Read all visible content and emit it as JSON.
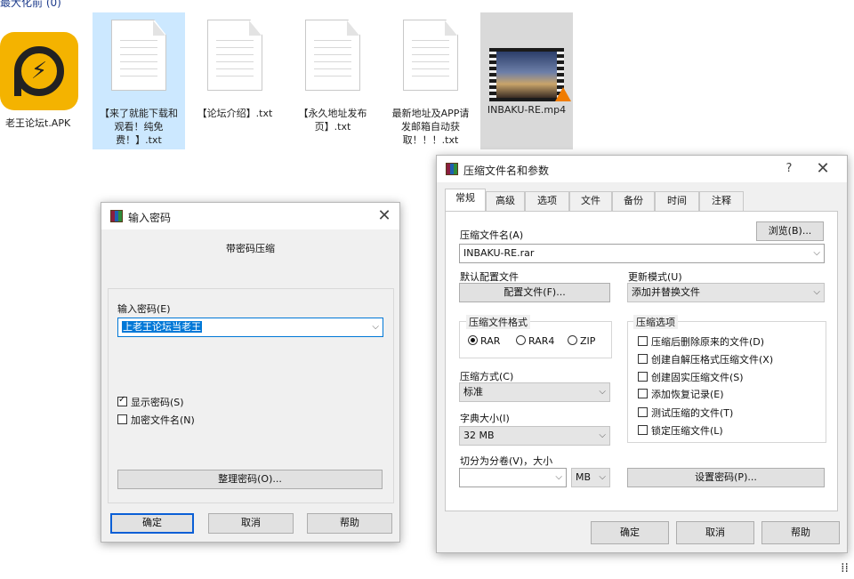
{
  "explorer": {
    "header_partial": "最大化前 (0)",
    "files": [
      {
        "name": "老王论坛t.APK",
        "type": "apk"
      },
      {
        "name": "【来了就能下载和观看！纯免费！】.txt",
        "type": "txt"
      },
      {
        "name": "【论坛介绍】.txt",
        "type": "txt"
      },
      {
        "name": "【永久地址发布页】.txt",
        "type": "txt"
      },
      {
        "name": "最新地址及APP请发邮箱自动获取！！！.txt",
        "type": "txt"
      },
      {
        "name": "INBAKU-RE.mp4",
        "type": "mp4"
      }
    ]
  },
  "password_dialog": {
    "title": "输入密码",
    "subtitle": "带密码压缩",
    "password_label": "输入密码(E)",
    "password_value": "上老王论坛当老王",
    "show_password_label": "显示密码(S)",
    "show_password_checked": true,
    "encrypt_names_label": "加密文件名(N)",
    "encrypt_names_checked": false,
    "manage_button": "整理密码(O)...",
    "ok_button": "确定",
    "cancel_button": "取消",
    "help_button": "帮助"
  },
  "archive_dialog": {
    "title": "压缩文件名和参数",
    "help_glyph": "?",
    "tabs": [
      "常规",
      "高级",
      "选项",
      "文件",
      "备份",
      "时间",
      "注释"
    ],
    "active_tab": "常规",
    "archive_name_label": "压缩文件名(A)",
    "browse_button": "浏览(B)...",
    "archive_name_value": "INBAKU-RE.rar",
    "default_profile_label": "默认配置文件",
    "profile_button": "配置文件(F)...",
    "update_mode_label": "更新模式(U)",
    "update_mode_value": "添加并替换文件",
    "format_group_title": "压缩文件格式",
    "formats": [
      "RAR",
      "RAR4",
      "ZIP"
    ],
    "selected_format": "RAR",
    "options_group_title": "压缩选项",
    "options": [
      {
        "label": "压缩后删除原来的文件(D)",
        "checked": false
      },
      {
        "label": "创建自解压格式压缩文件(X)",
        "checked": false
      },
      {
        "label": "创建固实压缩文件(S)",
        "checked": false
      },
      {
        "label": "添加恢复记录(E)",
        "checked": false
      },
      {
        "label": "测试压缩的文件(T)",
        "checked": false
      },
      {
        "label": "锁定压缩文件(L)",
        "checked": false
      }
    ],
    "method_label": "压缩方式(C)",
    "method_value": "标准",
    "dict_label": "字典大小(I)",
    "dict_value": "32 MB",
    "split_label": "切分为分卷(V)，大小",
    "split_value": "",
    "split_unit": "MB",
    "set_password_button": "设置密码(P)...",
    "ok_button": "确定",
    "cancel_button": "取消",
    "help_button": "帮助"
  },
  "colors": {
    "selection_blue": "#0078d7",
    "selected_item_bg": "#cce8ff",
    "dialog_bg": "#f0f0f0",
    "default_button_border": "#0a5fd6"
  },
  "icons": [
    "apk-app-icon",
    "text-document-icon",
    "video-file-icon",
    "winrar-icon",
    "close-icon",
    "chevron-down-icon",
    "corner-grip-icon"
  ]
}
